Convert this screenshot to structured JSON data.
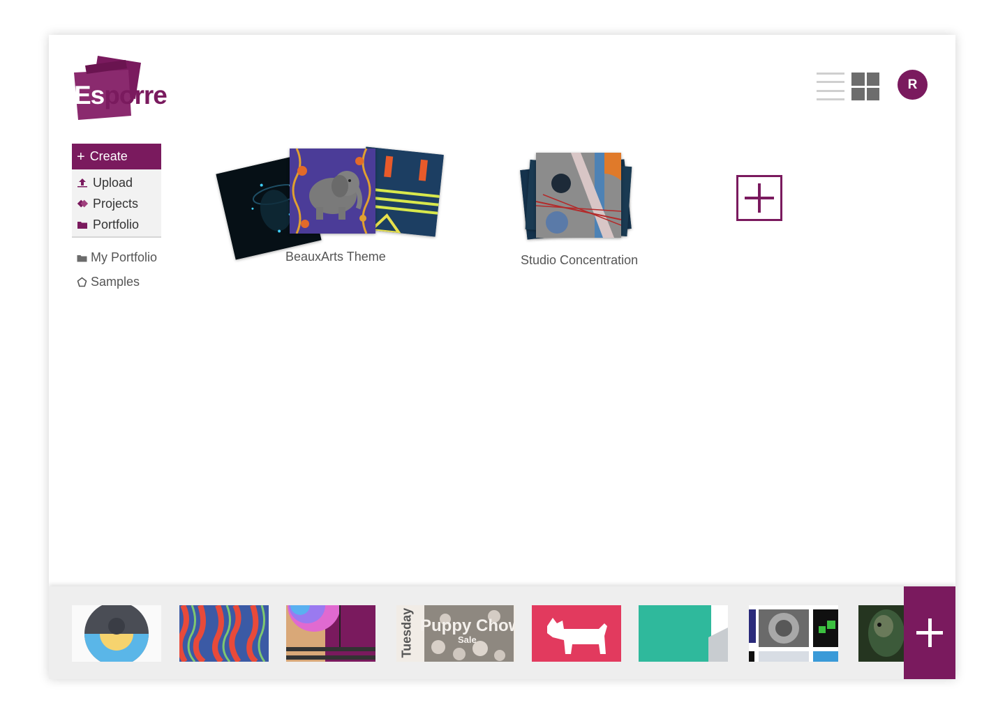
{
  "app": {
    "logo_text_first": "Es",
    "logo_text_rest": "porre",
    "accent_color": "#7a1a5e"
  },
  "header": {
    "list_view_icon": "list-view-icon",
    "grid_view_icon": "grid-view-icon",
    "avatar_initial": "R"
  },
  "sidebar": {
    "create_label": "Create",
    "items": [
      {
        "label": "Upload",
        "icon": "upload-icon"
      },
      {
        "label": "Projects",
        "icon": "projects-icon"
      },
      {
        "label": "Portfolio",
        "icon": "portfolio-icon"
      }
    ],
    "secondary": [
      {
        "label": "My Portfolio",
        "icon": "folder-icon"
      },
      {
        "label": "Samples",
        "icon": "pentagon-icon"
      }
    ]
  },
  "projects": [
    {
      "title": "BeauxArts Theme"
    },
    {
      "title": "Studio Concentration"
    }
  ],
  "tray": {
    "thumbnails": [
      {
        "name": "camera-app"
      },
      {
        "name": "coral-pattern"
      },
      {
        "name": "color-picker"
      },
      {
        "name": "puppy-chow-sale",
        "side_text": "Tuesday",
        "title_text": "Puppy Chow",
        "sub_text": "Sale"
      },
      {
        "name": "dog-silhouette"
      },
      {
        "name": "teal-slide"
      },
      {
        "name": "speaker-render"
      },
      {
        "name": "parrot-photo"
      }
    ],
    "fab_icon": "plus-icon"
  }
}
